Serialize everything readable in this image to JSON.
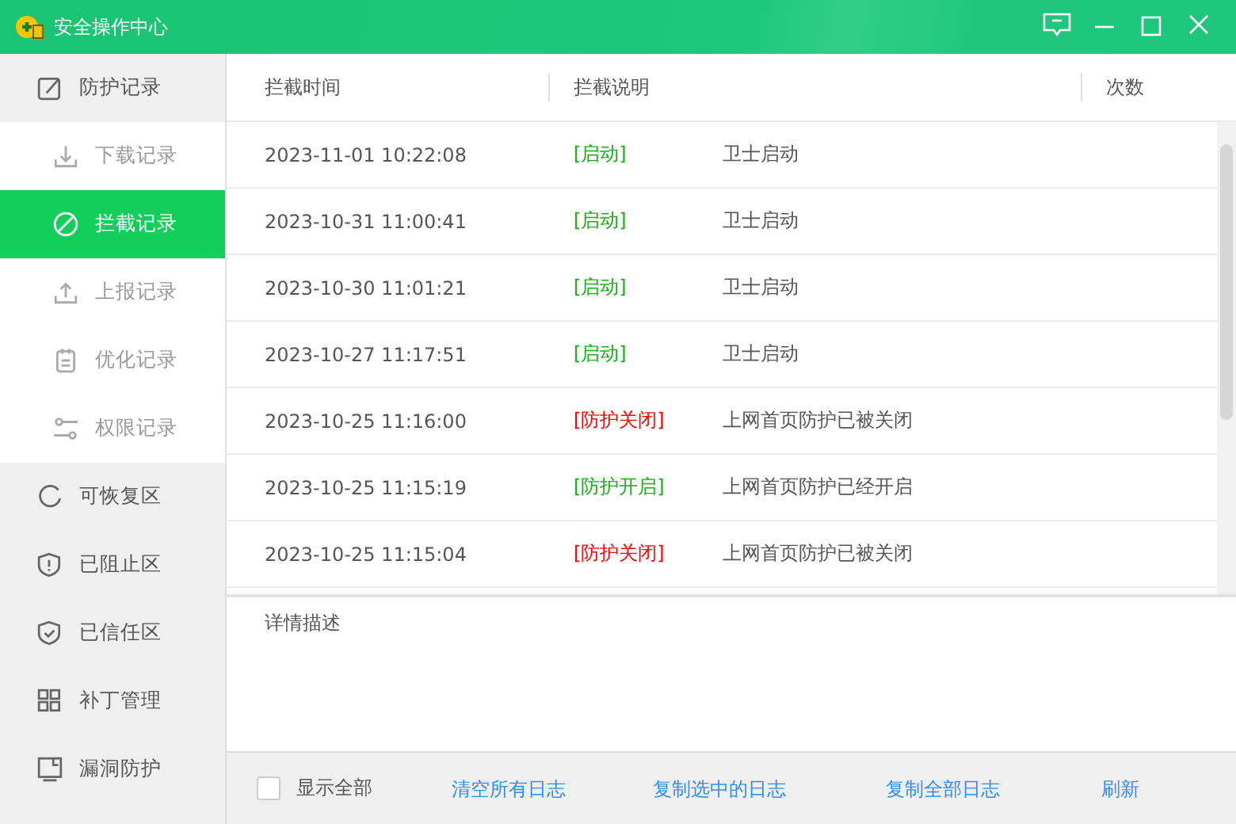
{
  "window": {
    "title": "安全操作中心"
  },
  "sidebar": {
    "items": [
      {
        "label": "防护记录",
        "selected": false,
        "expanded": true,
        "children": [
          {
            "label": "下载记录",
            "selected": false
          },
          {
            "label": "拦截记录",
            "selected": true
          },
          {
            "label": "上报记录",
            "selected": false
          },
          {
            "label": "优化记录",
            "selected": false
          },
          {
            "label": "权限记录",
            "selected": false
          }
        ]
      },
      {
        "label": "可恢复区",
        "selected": false
      },
      {
        "label": "已阻止区",
        "selected": false
      },
      {
        "label": "已信任区",
        "selected": false
      },
      {
        "label": "补丁管理",
        "selected": false
      },
      {
        "label": "漏洞防护",
        "selected": false
      }
    ]
  },
  "table": {
    "columns": [
      "拦截时间",
      "拦截说明",
      "次数"
    ],
    "rows": [
      {
        "time": "2023-11-01 10:22:08",
        "status": "[启动]",
        "color": "#1aad19",
        "description": "卫士启动"
      },
      {
        "time": "2023-10-31 11:00:41",
        "status": "[启动]",
        "color": "#1aad19",
        "description": "卫士启动"
      },
      {
        "time": "2023-10-30 11:01:21",
        "status": "[启动]",
        "color": "#1aad19",
        "description": "卫士启动"
      },
      {
        "time": "2023-10-27 11:17:51",
        "status": "[启动]",
        "color": "#1aad19",
        "description": "卫士启动"
      },
      {
        "time": "2023-10-25 11:16:00",
        "status": "[防护关闭]",
        "color": "#ff0000",
        "description": "上网首页防护已被关闭"
      },
      {
        "time": "2023-10-25 11:15:19",
        "status": "[防护开启]",
        "color": "#1aad19",
        "description": "上网首页防护已经开启"
      },
      {
        "time": "2023-10-25 11:15:04",
        "status": "[防护关闭]",
        "color": "#ff0000",
        "description": "上网首页防护已被关闭"
      }
    ]
  },
  "details": {
    "label": "详情描述"
  },
  "footer": {
    "checkbox": {
      "label": "显示全部",
      "checked": false
    },
    "links": [
      "清空所有日志",
      "复制选中的日志",
      "复制全部日志",
      "刷新"
    ]
  }
}
